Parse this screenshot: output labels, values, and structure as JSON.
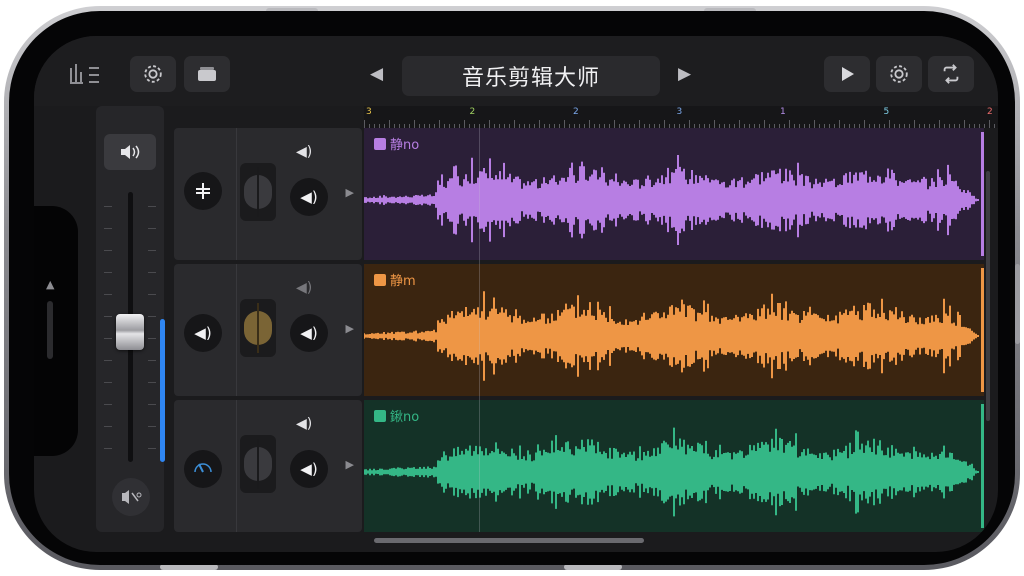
{
  "app": {
    "title": "音乐剪辑大师"
  },
  "transport": {
    "prev_icon": "chevron-left",
    "next_icon": "chevron-right",
    "play_icon": "play"
  },
  "toolbar": {
    "left_icons": [
      "tracks-view-icon",
      "settings-gear-icon",
      "browser-icon"
    ],
    "right_icons": [
      "play-icon",
      "settings-gear-icon",
      "loop-icon"
    ]
  },
  "ruler": {
    "bars": [
      "3",
      "2",
      "2",
      "3",
      "1",
      "5",
      "2"
    ]
  },
  "tracks": [
    {
      "name": "静no",
      "color": "#b77ee3",
      "region_bg": "#2b1f38",
      "header_icon": "eq-icon",
      "pan_color": "#3a3a3e"
    },
    {
      "name": "静m",
      "color": "#ee9645",
      "region_bg": "#3b2510",
      "header_icon": "volume-icon",
      "pan_color": "#7a6435"
    },
    {
      "name": "鍬no",
      "color": "#34b786",
      "region_bg": "#143227",
      "header_icon": "tuner-icon",
      "pan_color": "#3a3a3e"
    }
  ],
  "mixer": {
    "volume_level": 0.52,
    "icon": "master-volume-icon"
  }
}
